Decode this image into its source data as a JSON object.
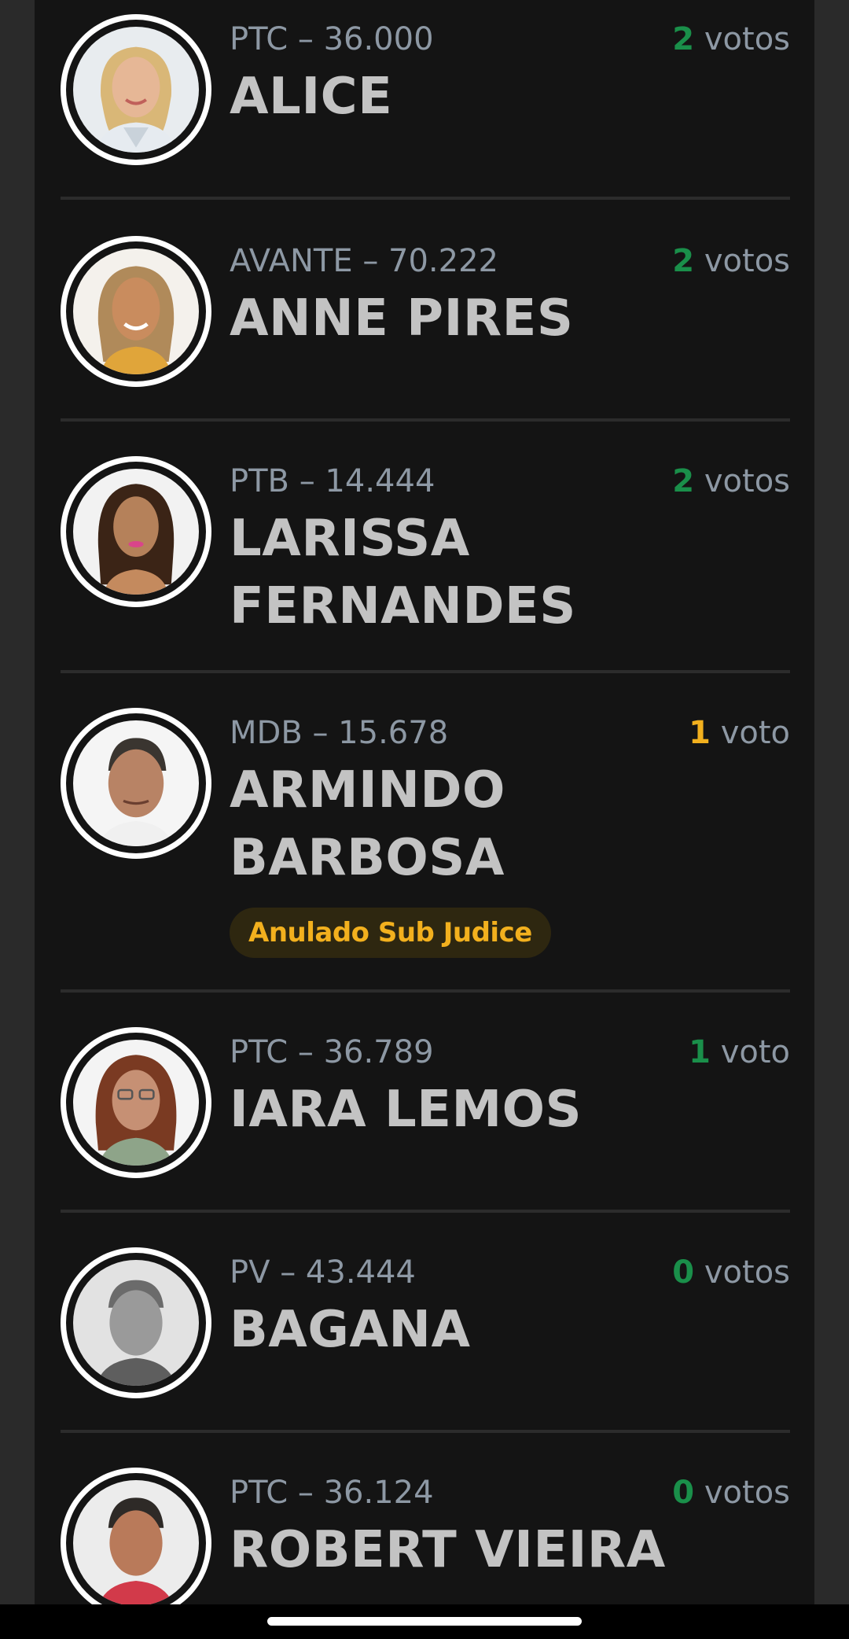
{
  "candidates": [
    {
      "party_number": "PTC – 36.000",
      "name": "ALICE",
      "votes": "2",
      "votes_unit": "votos",
      "vote_color": "#1a8f4a",
      "photo": "woman-blonde-portrait"
    },
    {
      "party_number": "AVANTE – 70.222",
      "name": "ANNE PIRES",
      "votes": "2",
      "votes_unit": "votos",
      "vote_color": "#1a8f4a",
      "photo": "woman-smiling-portrait"
    },
    {
      "party_number": "PTB – 14.444",
      "name": "LARISSA FERNANDES",
      "votes": "2",
      "votes_unit": "votos",
      "vote_color": "#1a8f4a",
      "photo": "woman-dark-hair-portrait"
    },
    {
      "party_number": "MDB – 15.678",
      "name": "ARMINDO BARBOSA",
      "votes": "1",
      "votes_unit": "voto",
      "vote_color": "#f2b01e",
      "badge": "Anulado Sub Judice",
      "photo": "man-older-portrait"
    },
    {
      "party_number": "PTC – 36.789",
      "name": "IARA LEMOS",
      "votes": "1",
      "votes_unit": "voto",
      "vote_color": "#1a8f4a",
      "photo": "woman-glasses-portrait"
    },
    {
      "party_number": "PV – 43.444",
      "name": "BAGANA",
      "votes": "0",
      "votes_unit": "votos",
      "vote_color": "#1a8f4a",
      "photo": "man-grayscale-portrait"
    },
    {
      "party_number": "PTC – 36.124",
      "name": "ROBERT VIEIRA",
      "votes": "0",
      "votes_unit": "votos",
      "vote_color": "#1a8f4a",
      "photo": "man-portrait"
    }
  ],
  "colors": {
    "background": "#141414",
    "name_text": "#c3c3c3",
    "party_text": "#8d98a4",
    "votes_green": "#1a8f4a",
    "votes_amber": "#f2b01e",
    "badge_bg": "#2e2710"
  }
}
